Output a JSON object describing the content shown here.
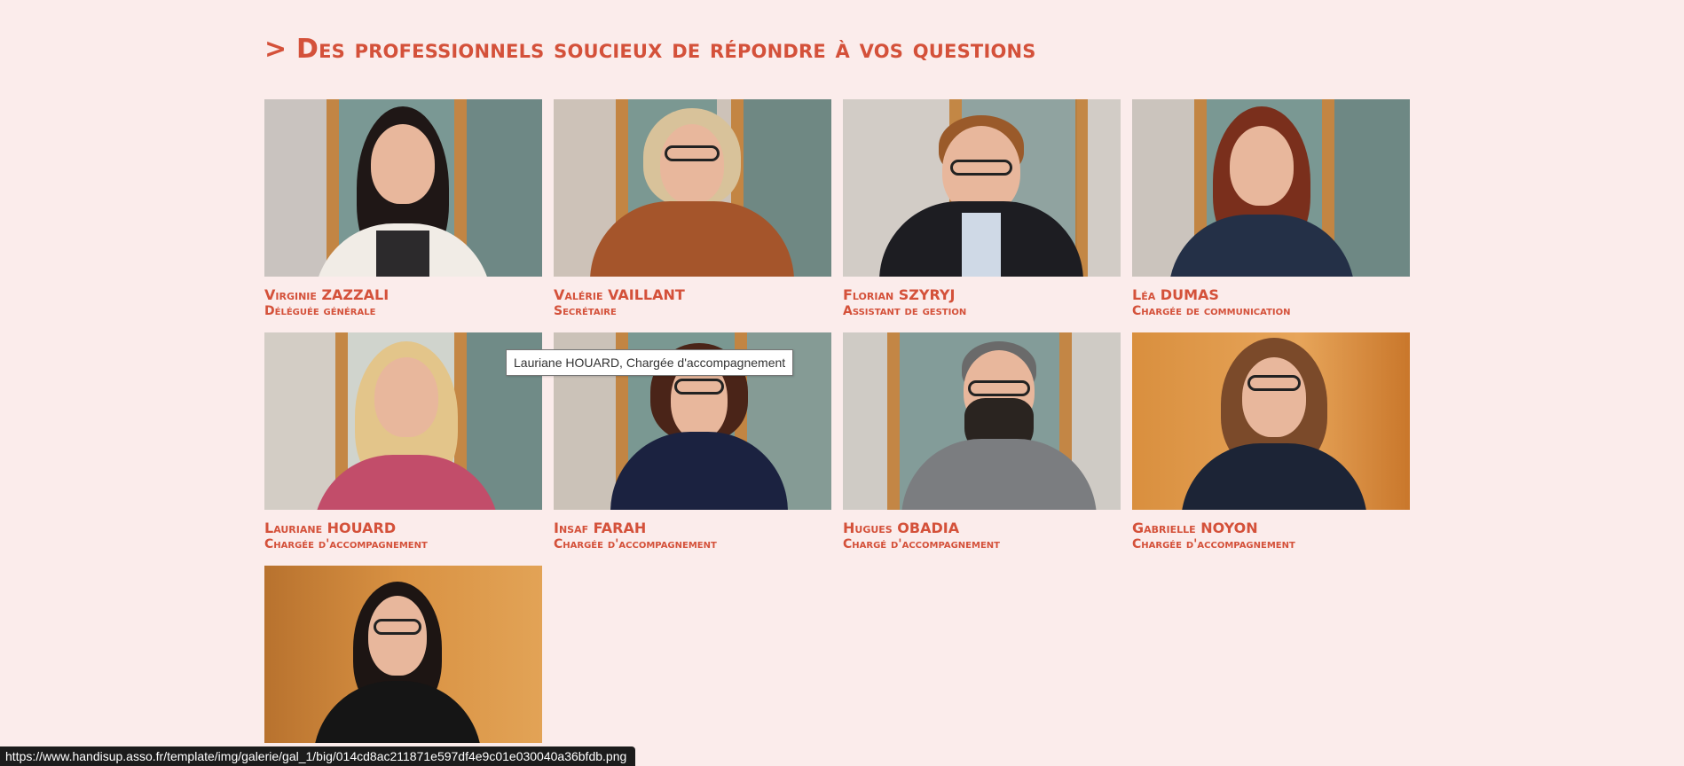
{
  "section": {
    "title": "> Des professionnels soucieux de répondre à vos questions"
  },
  "team": [
    {
      "name": "Virginie ZAZZALI",
      "role": "Déléguée générale",
      "photo": "portrait-photo"
    },
    {
      "name": "Valérie VAILLANT",
      "role": "Secrétaire",
      "photo": "portrait-photo"
    },
    {
      "name": "Florian SZYRYJ",
      "role": "Assistant de gestion",
      "photo": "portrait-photo"
    },
    {
      "name": "Léa DUMAS",
      "role": "Chargée de communication",
      "photo": "portrait-photo"
    },
    {
      "name": "Lauriane HOUARD",
      "role": "Chargée d'accompagnement",
      "photo": "portrait-photo"
    },
    {
      "name": "Insaf FARAH",
      "role": "Chargée d'accompagnement",
      "photo": "portrait-photo"
    },
    {
      "name": "Hugues OBADIA",
      "role": "Chargé d'accompagnement",
      "photo": "portrait-photo"
    },
    {
      "name": "Gabrielle NOYON",
      "role": "Chargée d'accompagnement",
      "photo": "portrait-photo"
    },
    {
      "name": "",
      "role": "",
      "photo": "portrait-photo"
    }
  ],
  "tooltip": {
    "text": "Lauriane HOUARD, Chargée d'accompagnement"
  },
  "status_bar": {
    "url": "https://www.handisup.asso.fr/template/img/galerie/gal_1/big/014cd8ac211871e597df4e9c01e030040a36bfdb.png"
  },
  "colors": {
    "background": "#fbeceb",
    "accent": "#d4513a"
  }
}
